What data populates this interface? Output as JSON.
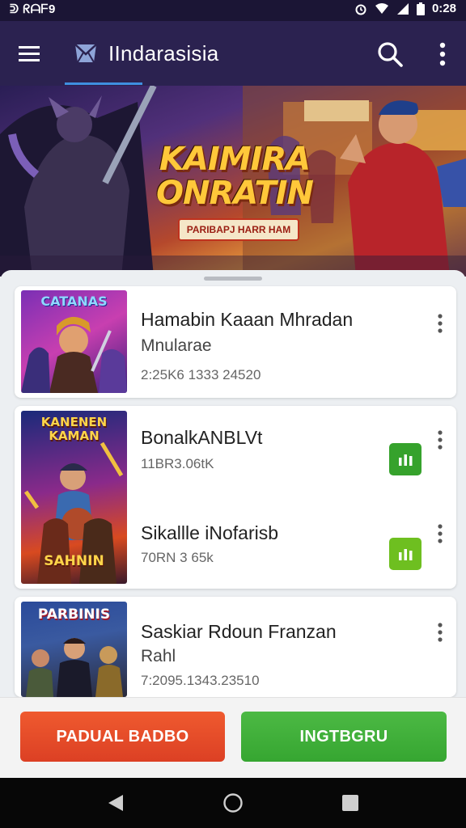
{
  "status_bar": {
    "left_text": "ᕲ ᖇᗩᖴ9",
    "time": "0:28"
  },
  "app_bar": {
    "title": "IIndarasisia"
  },
  "hero": {
    "title_line1": "KAIMIRA",
    "title_line2": "ONRATIN",
    "subtitle": "PARIBAPJ HARR HAM"
  },
  "items": [
    {
      "thumb_label": "CATANAS",
      "title": "Hamabin Kaaan Mhradan",
      "subtitle": "Mnularae",
      "meta": "2:25K6 1333 24520"
    },
    {
      "thumb_label": "KANENEN KAMAN",
      "thumb_bottom": "SAHNIN",
      "title": "BonalkANBLVt",
      "meta": "11BR3.06tK",
      "title2": "Sikallle iNofarisb",
      "meta2": "70RN 3 65k"
    },
    {
      "thumb_label": "PARBINIS",
      "title": "Saskiar Rdoun Franzan",
      "subtitle": "Rahl",
      "meta": "7:2095.1343.23510"
    }
  ],
  "buttons": {
    "left": "PADUAL BADBO",
    "right": "INGTBGRU"
  },
  "colors": {
    "app_bar": "#2b2250",
    "accent_blue": "#3f8fe0",
    "red_button": "#e44a28",
    "green_button": "#3faf39",
    "badge_green": "#36a22c",
    "badge_lime": "#6ebf20"
  },
  "icons": [
    "menu-icon",
    "app-logo-icon",
    "search-icon",
    "more-vert-icon",
    "back-icon",
    "home-icon",
    "recents-icon",
    "signal-icon",
    "wifi-icon",
    "battery-icon",
    "bar-chart-icon"
  ]
}
